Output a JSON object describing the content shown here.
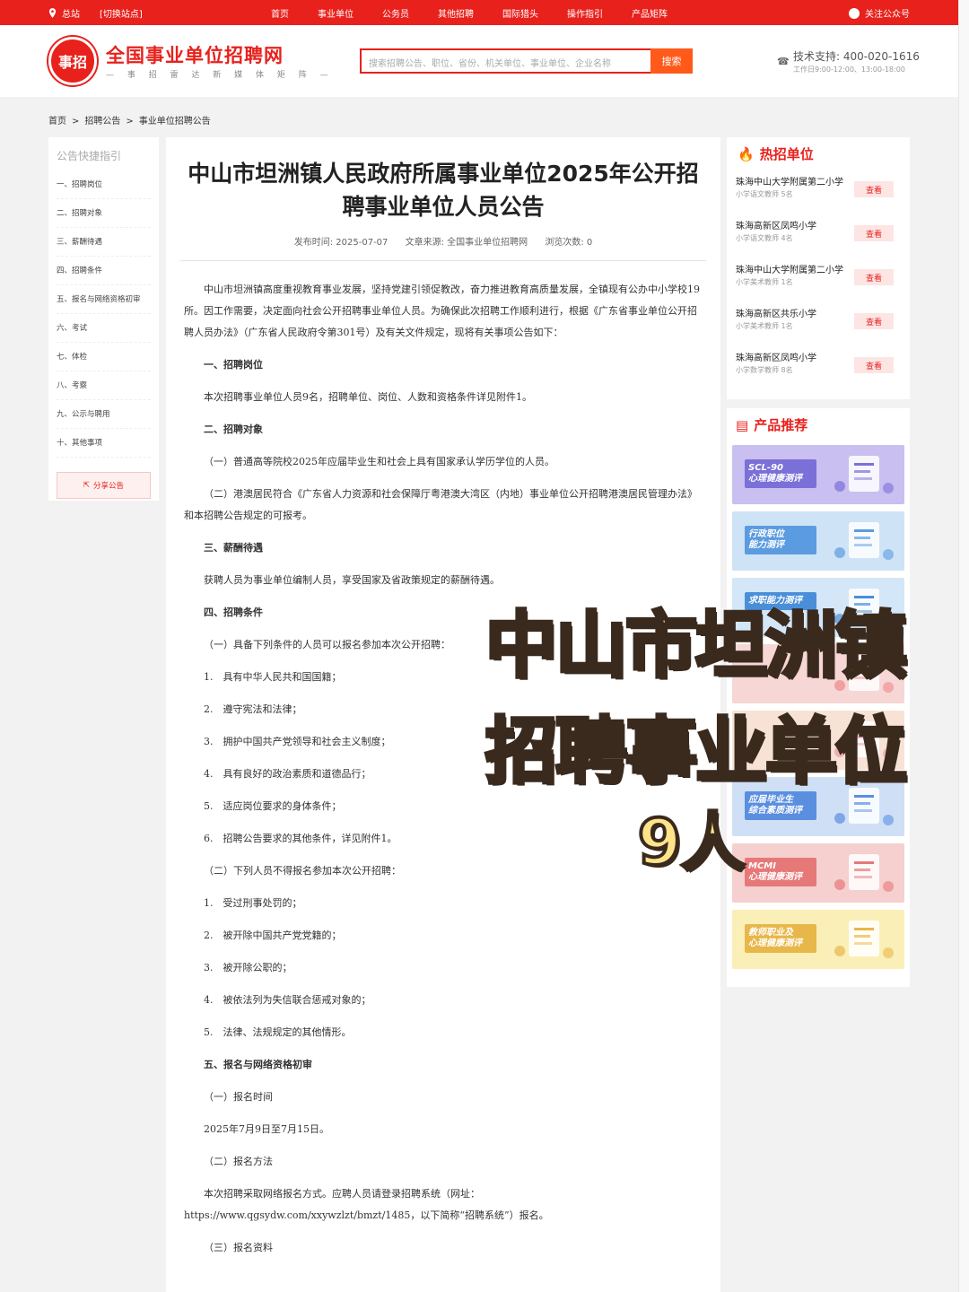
{
  "topbar": {
    "station": "总站",
    "switch_station": "[切换站点]",
    "nav": [
      "首页",
      "事业单位",
      "公务员",
      "其他招聘",
      "国际猎头",
      "操作指引",
      "产品矩阵"
    ],
    "follow": "关注公众号"
  },
  "header": {
    "logo_badge": "事招",
    "logo_title": "全国事业单位招聘网",
    "logo_subtitle": "— 事 招 雷 达 新 媒 体 矩 阵 —",
    "search_placeholder": "搜索招聘公告、职位、省份、机关单位、事业单位、企业名称",
    "search_button": "搜索",
    "support_line": "技术支持: 400-020-1616",
    "support_hours": "工作日9:00-12:00、13:00-18:00"
  },
  "breadcrumb": [
    "首页",
    "招聘公告",
    "事业单位招聘公告"
  ],
  "left_nav": {
    "title": "公告快捷指引",
    "items": [
      "一、招聘岗位",
      "二、招聘对象",
      "三、薪酬待遇",
      "四、招聘条件",
      "五、报名与网络资格初审",
      "六、考试",
      "七、体检",
      "八、考察",
      "九、公示与聘用",
      "十、其他事项"
    ],
    "share": "分享公告"
  },
  "article": {
    "title": "中山市坦洲镇人民政府所属事业单位2025年公开招聘事业单位人员公告",
    "publish_time": "发布时间: 2025-07-07",
    "source": "文章来源: 全国事业单位招聘网",
    "views": "浏览次数: 0",
    "paragraphs": [
      {
        "type": "ind",
        "text": "中山市坦洲镇高度重视教育事业发展，坚持党建引领促教改，奋力推进教育高质量发展，全镇现有公办中小学校19所。因工作需要，决定面向社会公开招聘事业单位人员。为确保此次招聘工作顺利进行，根据《广东省事业单位公开招聘人员办法》（广东省人民政府令第301号）及有关文件规定，现将有关事项公告如下："
      },
      {
        "type": "h",
        "text": "一、招聘岗位"
      },
      {
        "type": "ind",
        "text": "本次招聘事业单位人员9名，招聘单位、岗位、人数和资格条件详见附件1。"
      },
      {
        "type": "h",
        "text": "二、招聘对象"
      },
      {
        "type": "ind",
        "text": "（一）普通高等院校2025年应届毕业生和社会上具有国家承认学历学位的人员。"
      },
      {
        "type": "ind",
        "text": "（二）港澳居民符合《广东省人力资源和社会保障厅粤港澳大湾区（内地）事业单位公开招聘港澳居民管理办法》和本招聘公告规定的可报考。"
      },
      {
        "type": "h",
        "text": "三、薪酬待遇"
      },
      {
        "type": "ind",
        "text": "获聘人员为事业单位编制人员，享受国家及省政策规定的薪酬待遇。"
      },
      {
        "type": "h",
        "text": "四、招聘条件"
      },
      {
        "type": "ind",
        "text": "（一）具备下列条件的人员可以报名参加本次公开招聘："
      },
      {
        "type": "ind",
        "text": "1.　具有中华人民共和国国籍；"
      },
      {
        "type": "ind",
        "text": "2.　遵守宪法和法律；"
      },
      {
        "type": "ind",
        "text": "3.　拥护中国共产党领导和社会主义制度；"
      },
      {
        "type": "ind",
        "text": "4.　具有良好的政治素质和道德品行；"
      },
      {
        "type": "ind",
        "text": "5.　适应岗位要求的身体条件；"
      },
      {
        "type": "ind",
        "text": "6.　招聘公告要求的其他条件，详见附件1。"
      },
      {
        "type": "ind",
        "text": "（二）下列人员不得报名参加本次公开招聘："
      },
      {
        "type": "ind",
        "text": "1.　受过刑事处罚的；"
      },
      {
        "type": "ind",
        "text": "2.　被开除中国共产党党籍的；"
      },
      {
        "type": "ind",
        "text": "3.　被开除公职的；"
      },
      {
        "type": "ind",
        "text": "4.　被依法列为失信联合惩戒对象的；"
      },
      {
        "type": "ind",
        "text": "5.　法律、法规规定的其他情形。"
      },
      {
        "type": "h",
        "text": "五、报名与网络资格初审"
      },
      {
        "type": "ind",
        "text": "（一）报名时间"
      },
      {
        "type": "ind",
        "text": "2025年7月9日至7月15日。"
      },
      {
        "type": "ind",
        "text": "（二）报名方法"
      },
      {
        "type": "ind",
        "text": "本次招聘采取网络报名方式。应聘人员请登录招聘系统（网址：https://www.qgsydw.com/xxywzlzt/bmzt/1485，以下简称“招聘系统”）报名。"
      },
      {
        "type": "ind",
        "text": "（三）报名资料"
      }
    ]
  },
  "hot_units": {
    "title": "热招单位",
    "items": [
      {
        "name": "珠海中山大学附属第二小学",
        "post": "小学语文教师 5名",
        "btn": "查看"
      },
      {
        "name": "珠海高新区凤鸣小学",
        "post": "小学语文教师 4名",
        "btn": "查看"
      },
      {
        "name": "珠海中山大学附属第二小学",
        "post": "小学美术教师 1名",
        "btn": "查看"
      },
      {
        "name": "珠海高新区共乐小学",
        "post": "小学美术教师 1名",
        "btn": "查看"
      },
      {
        "name": "珠海高新区凤鸣小学",
        "post": "小学数学教师 8名",
        "btn": "查看"
      }
    ]
  },
  "products": {
    "title": "产品推荐",
    "banners": [
      {
        "label": "SCL-90\n心理健康测评",
        "bg": "#c9bff0",
        "tag": "#7b6fd8"
      },
      {
        "label": "行政职位\n能力测评",
        "bg": "#cfe3f7",
        "tag": "#5b9bdf"
      },
      {
        "label": "求职能力测评",
        "bg": "#d3e7f8",
        "tag": "#4b8ed8"
      },
      {
        "label": "",
        "bg": "#f7d6d6",
        "tag": "#e88"
      },
      {
        "label": "",
        "bg": "#f8e2d6",
        "tag": "#e9a"
      },
      {
        "label": "应届毕业生\n综合素质测评",
        "bg": "#cfe0f6",
        "tag": "#5a8fe0"
      },
      {
        "label": "MCMI\n心理健康测评",
        "bg": "#f6cfcf",
        "tag": "#e77878"
      },
      {
        "label": "教师职业及\n心理健康测评",
        "bg": "#fbefb8",
        "tag": "#e8b74a"
      }
    ]
  },
  "overlay": {
    "line1": "中山市坦洲镇",
    "line2": "招聘事业单位",
    "line3": "9人"
  }
}
